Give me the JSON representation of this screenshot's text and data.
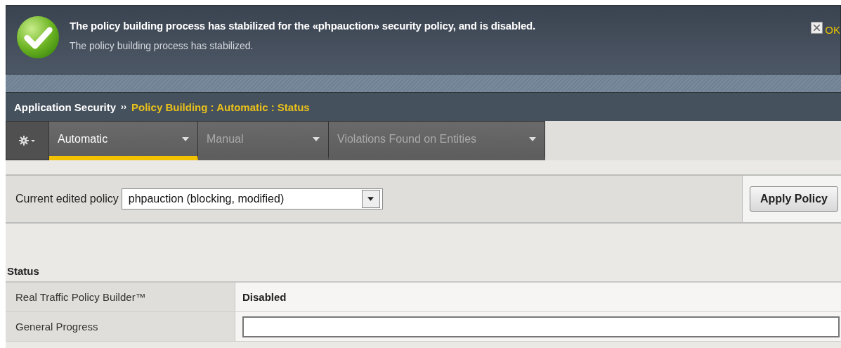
{
  "notification": {
    "title": "The policy building process has stabilized for the «phpauction» security policy, and is disabled.",
    "message": "The policy building process has stabilized.",
    "dismiss": "OK"
  },
  "breadcrumb": {
    "root": "Application Security",
    "separator": "››",
    "current": "Policy Building : Automatic : Status"
  },
  "tabs": [
    {
      "label": "Automatic",
      "selected": true
    },
    {
      "label": "Manual",
      "selected": false
    },
    {
      "label": "Violations Found on Entities",
      "selected": false
    }
  ],
  "policy_bar": {
    "label": "Current edited policy",
    "value": "phpauction (blocking, modified)",
    "button": "Apply Policy"
  },
  "status": {
    "heading": "Status",
    "rows": [
      {
        "label": "Real Traffic Policy Builder™",
        "kind": "text",
        "value": "Disabled"
      },
      {
        "label": "General Progress",
        "kind": "progress"
      }
    ]
  }
}
